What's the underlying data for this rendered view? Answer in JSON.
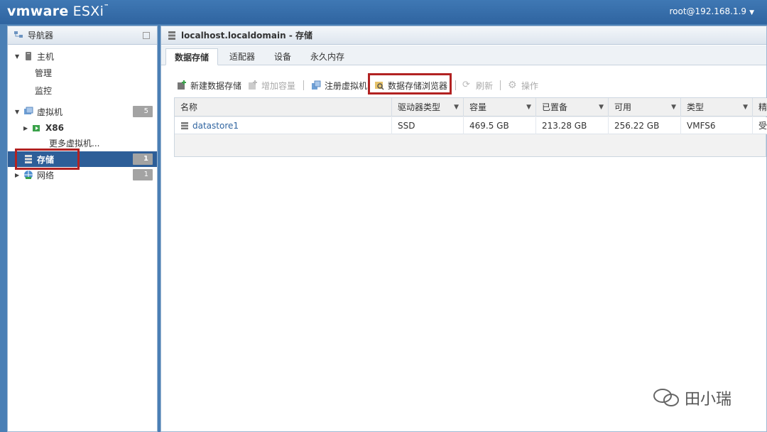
{
  "topbar": {
    "brand_vm": "vmware",
    "brand_product": "ESXi",
    "tm": "™",
    "user": "root@192.168.1.9",
    "caret": "▼"
  },
  "navigator": {
    "title": "导航器",
    "host": {
      "label": "主机",
      "children": [
        "管理",
        "监控"
      ]
    },
    "vms": {
      "label": "虚拟机",
      "count": "5",
      "children": [
        {
          "label": "X86"
        }
      ],
      "more": "更多虚拟机..."
    },
    "storage": {
      "label": "存储",
      "count": "1"
    },
    "network": {
      "label": "网络",
      "count": "1"
    }
  },
  "content": {
    "title": "localhost.localdomain - 存储",
    "tabs": [
      "数据存储",
      "适配器",
      "设备",
      "永久内存"
    ],
    "toolbar": {
      "new_datastore": "新建数据存储",
      "increase_capacity": "增加容量",
      "register_vm": "注册虚拟机",
      "datastore_browser": "数据存储浏览器",
      "refresh": "刷新",
      "actions": "操作"
    },
    "table": {
      "headers": [
        "名称",
        "驱动器类型",
        "容量",
        "已置备",
        "可用",
        "类型",
        "精"
      ],
      "rows": [
        [
          "datastore1",
          "SSD",
          "469.5 GB",
          "213.28 GB",
          "256.22 GB",
          "VMFS6",
          "受"
        ]
      ]
    }
  },
  "watermark": {
    "text": "田小瑞"
  },
  "colors": {
    "header_blue": "#2f64a0",
    "highlight_red": "#b22222",
    "selected_nav": "#2d5e98"
  }
}
